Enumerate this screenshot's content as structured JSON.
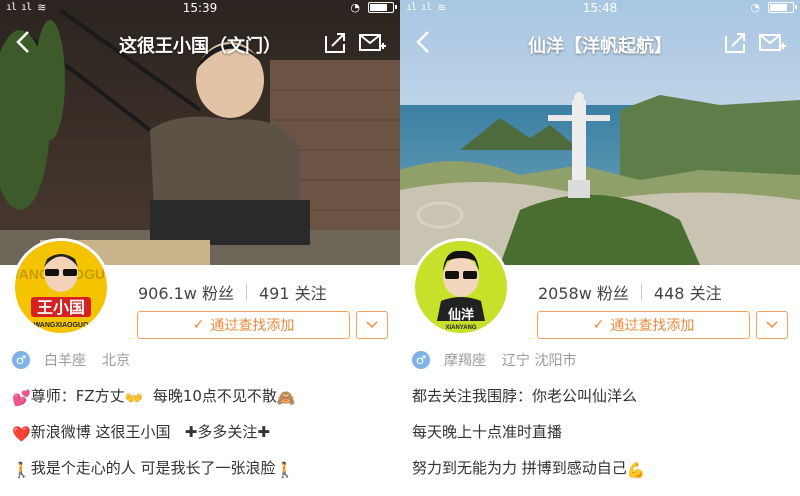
{
  "left": {
    "status_time": "15:39",
    "title": "这很王小国（文门）",
    "avatar_text": "王小国",
    "avatar_subtext": "WANGXIAOGUO",
    "avatar_bg_text": "WANGXIAOGUO",
    "fans_count": "906.1w",
    "fans_label": "粉丝",
    "following_count": "491",
    "following_label": "关注",
    "follow_button_label": "通过查找添加",
    "zodiac": "白羊座",
    "location": "北京",
    "bio_lines": [
      "尊师：FZ方丈",
      "每晚10点不见不散",
      "新浪微博 这很王小国",
      "多多关注",
      "我是个走心的人 可是我长了一张浪脸"
    ]
  },
  "right": {
    "status_time": "15:48",
    "title": "仙洋【洋帆起航】",
    "avatar_text": "仙洋",
    "avatar_subtext": "XIANYANG",
    "fans_count": "2058w",
    "fans_label": "粉丝",
    "following_count": "448",
    "following_label": "关注",
    "follow_button_label": "通过查找添加",
    "zodiac": "摩羯座",
    "location": "辽宁 沈阳市",
    "bio_lines": [
      "都去关注我围脖：你老公叫仙洋么",
      "每天晚上十点准时直播",
      "努力到无能为力  拼博到感动自己"
    ]
  },
  "colors": {
    "accent": "#f08a3a",
    "accent_border": "#f5a25d",
    "gender_blue": "#7fb3e6",
    "meta_gray": "#9a9a9a"
  }
}
